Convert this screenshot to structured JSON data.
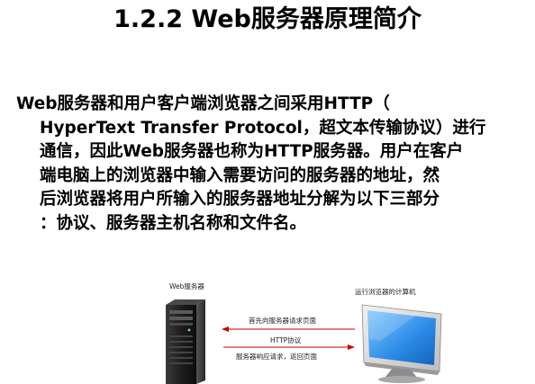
{
  "title": "1.2.2  Web服务器原理简介",
  "paragraph": {
    "lines": [
      "Web服务器和用户客户端浏览器之间采用HTTP（",
      "HyperText Transfer Protocol，超文本传输协议）进行",
      "通信，因此Web服务器也称为HTTP服务器。用户在客户",
      "端电脑上的浏览器中输入需要访问的服务器的地址，然",
      "后浏览器将用户所输入的服务器地址分解为以下三部分",
      "：协议、服务器主机名称和文件名。"
    ]
  },
  "diagram": {
    "server_label": "Web服务器",
    "client_label": "运行浏览器的计算机",
    "request_label": "首先向服务器请求页面",
    "protocol_label": "HTTP协议",
    "response_label": "服务器响应请求，返回页面",
    "arrow_color": "#cc0000"
  }
}
